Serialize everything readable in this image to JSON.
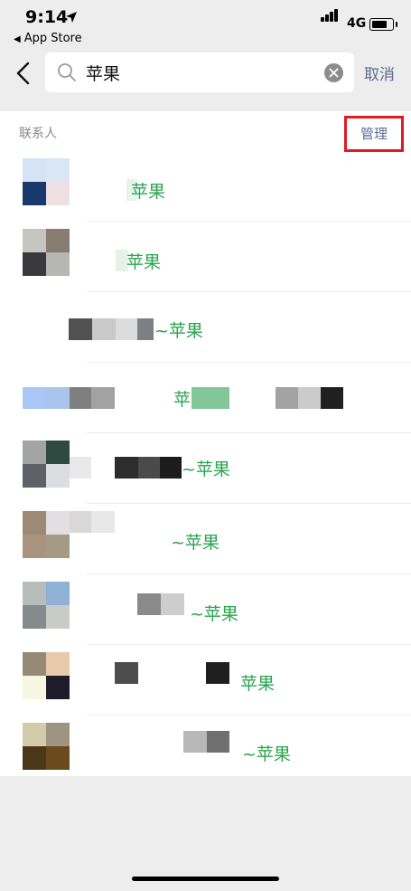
{
  "status_bar": {
    "time": "9:14",
    "back_app": "App Store",
    "network": "4G"
  },
  "search": {
    "query": "苹果",
    "cancel_label": "取消"
  },
  "section": {
    "title": "联系人",
    "manage_label": "管理"
  },
  "contacts": [
    {
      "match_text": "苹果"
    },
    {
      "match_text": "苹果"
    },
    {
      "match_text": "~苹果"
    },
    {
      "match_text": "苹"
    },
    {
      "match_text": "~苹果"
    },
    {
      "match_text": "~苹果"
    },
    {
      "match_text": "~苹果"
    },
    {
      "match_text": "苹果"
    },
    {
      "match_text": "~苹果"
    }
  ],
  "colors": {
    "match": "#2aa44f",
    "link": "#5b6b8f",
    "highlight_box": "#e11b22",
    "background": "#ededed"
  }
}
